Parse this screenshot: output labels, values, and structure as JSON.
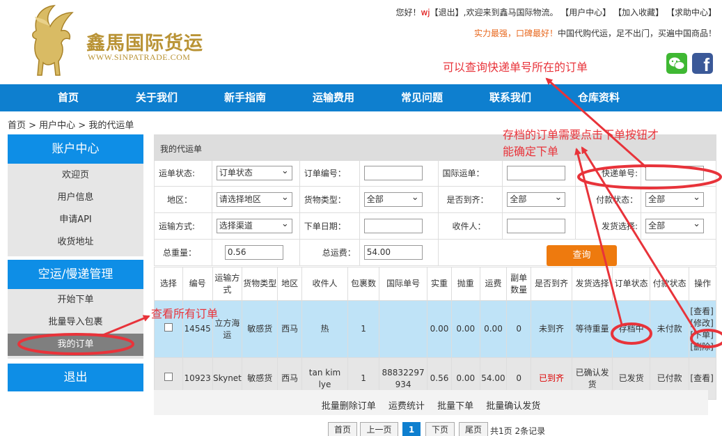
{
  "brand": {
    "title": "鑫馬国际货运",
    "url_text": "WWW.SINPATRADE.COM"
  },
  "topbar": {
    "greeting": "您好！",
    "user": "wj",
    "logout": "【退出】",
    "welcome": ",欢迎来到鑫马国际物流。",
    "user_center": "【用户中心】",
    "favorite": "【加入收藏】",
    "help": "【求助中心】"
  },
  "slogan": {
    "em": "实力最强，口碑最好！",
    "text": "中国代购代运，足不出门，买遍中国商品！"
  },
  "nav": [
    "首页",
    "关于我们",
    "新手指南",
    "运输费用",
    "常见问题",
    "联系我们",
    "仓库资料"
  ],
  "breadcrumb": "首页 > 用户中心 > 我的代运单",
  "sidebar": {
    "account_title": "账户中心",
    "account_items": [
      "欢迎页",
      "用户信息",
      "申请API",
      "收货地址"
    ],
    "air_title": "空运/慢递管理",
    "air_items": [
      "开始下单",
      "批量导入包裹",
      "我的订单"
    ],
    "exit": "退出"
  },
  "panel_title": "我的代运单",
  "form": {
    "order_status_label": "运单状态:",
    "order_status_value": "订单状态",
    "order_no_label": "订单编号：",
    "intl_no_label": "国际运单：",
    "express_no_label": "快递单号:",
    "region_label": "地区：",
    "region_value": "请选择地区",
    "goods_type_label": "货物类型：",
    "goods_type_value": "全部",
    "arrived_label": "是否到齐：",
    "arrived_value": "全部",
    "pay_status_label": "付款状态：",
    "pay_status_value": "全部",
    "ship_method_label": "运输方式:",
    "ship_method_value": "选择渠道",
    "order_date_label": "下单日期：",
    "receiver_label": "收件人：",
    "dispatch_label": "发货选择:",
    "dispatch_value": "全部",
    "total_weight_label": "总重量：",
    "total_weight_value": "0.56",
    "total_fee_label": "总运费：",
    "total_fee_value": "54.00",
    "query_button": "查询"
  },
  "table": {
    "headers": [
      "选择",
      "编号",
      "运输方式",
      "货物类型",
      "地区",
      "收件人",
      "包裹数",
      "国际单号",
      "实重",
      "抛重",
      "运费",
      "副单数量",
      "是否到齐",
      "发货选择",
      "订单状态",
      "付款状态",
      "操作"
    ],
    "rows": [
      {
        "id": "14545",
        "method": "立方海运",
        "goods": "敏感货",
        "region": "西马",
        "receiver": "热",
        "packages": "1",
        "intl_no": "",
        "weight": "0.00",
        "vol_weight": "0.00",
        "fee": "0.00",
        "sub_count": "0",
        "arrived": "未到齐",
        "dispatch": "等待重量",
        "status": "存档中",
        "pay": "未付款",
        "ops": [
          "[查看]",
          "[修改]",
          "[下单]",
          "[删除]"
        ]
      },
      {
        "id": "10923",
        "method": "Skynet",
        "goods": "敏感货",
        "region": "西马",
        "receiver": "tan kim lye",
        "packages": "1",
        "intl_no": "88832297934",
        "weight": "0.56",
        "vol_weight": "0.00",
        "fee": "54.00",
        "sub_count": "0",
        "arrived": "已到齐",
        "dispatch": "已确认发货",
        "status": "已发货",
        "pay": "已付款",
        "ops": [
          "[查看]"
        ]
      }
    ]
  },
  "batch": [
    "批量删除订单",
    "运费统计",
    "批量下单",
    "批量确认发货"
  ],
  "pager": {
    "first": "首页",
    "prev": "上一页",
    "current": "1",
    "next": "下页",
    "last": "尾页",
    "info": "共1页 2条记录"
  },
  "annotations": {
    "a1": "可以查询快递单号所在的订单",
    "a2_line1": "存档的订单需要点击下单按钮才",
    "a2_line2": "能确定下单",
    "a3": "查看所有订单"
  },
  "colors": {
    "nav": "#0e7fcf",
    "accent": "#ee7a0e",
    "annotation": "#e8333a",
    "gold": "#b99335"
  }
}
